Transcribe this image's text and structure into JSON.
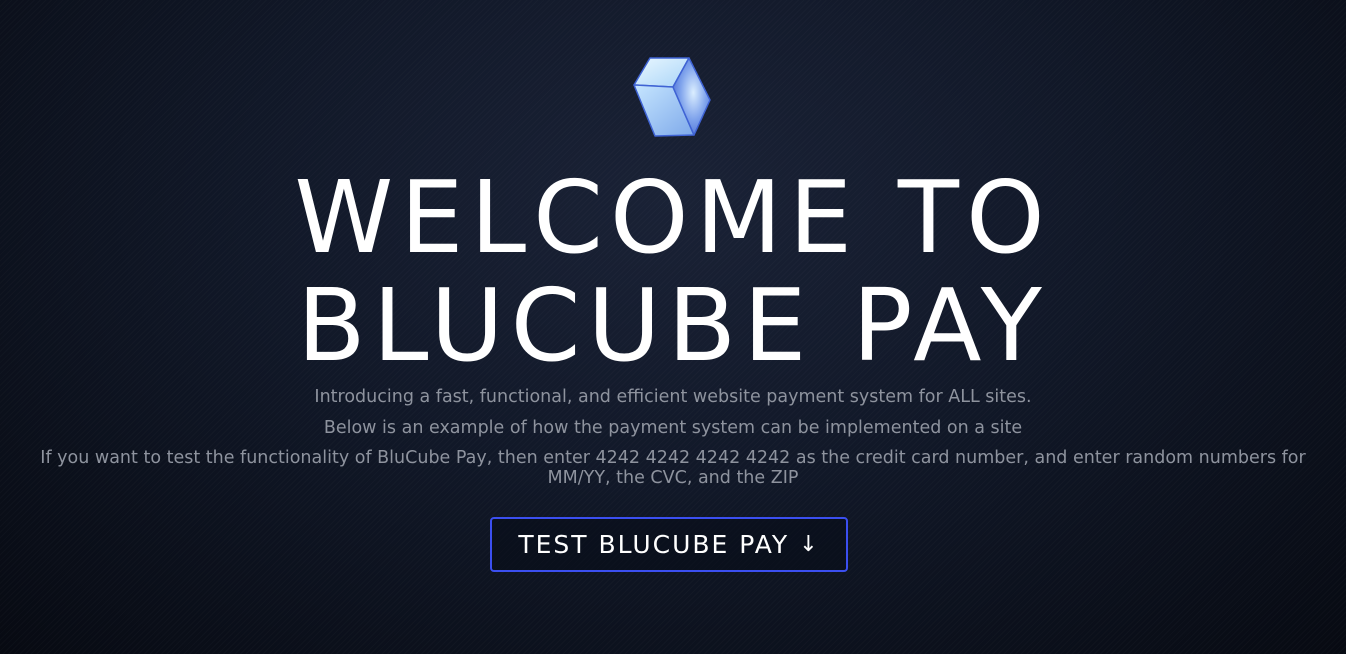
{
  "hero": {
    "logo_icon": "blue-cube-icon",
    "title_line1": "WELCOME TO",
    "title_line2": "BLUCUBE PAY",
    "description_lines": [
      "Introducing a fast, functional, and efficient website payment system for ALL sites.",
      "Below is an example of how the payment system can be implemented on a site",
      "If you want to test the functionality of BluCube Pay, then enter 4242 4242 4242 4242 as the credit card number, and enter random numbers for MM/YY, the CVC, and the ZIP"
    ],
    "cta_label": "TEST BLUCUBE PAY",
    "cta_arrow": "↓"
  },
  "colors": {
    "background": "#111828",
    "title_text": "#ffffff",
    "description_text": "#8e939e",
    "button_border": "#3b4ff0",
    "cube_light": "#c9e8ff",
    "cube_mid": "#8fb6ee",
    "cube_dark": "#4a72d8"
  }
}
